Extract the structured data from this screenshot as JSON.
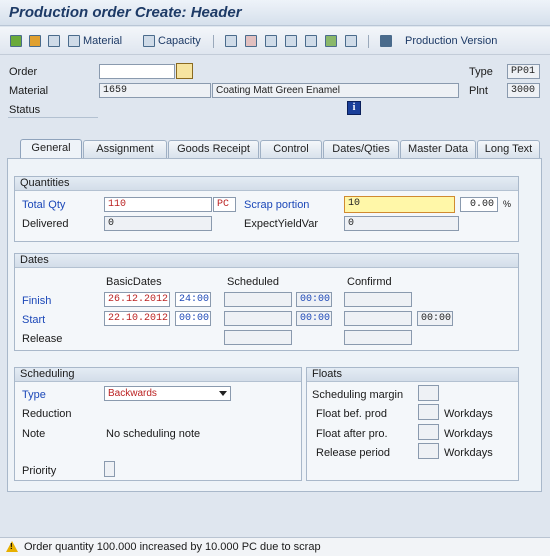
{
  "title": "Production order Create: Header",
  "toolbar": {
    "material_label": "Material",
    "capacity_label": "Capacity",
    "production_version_label": "Production Version"
  },
  "header": {
    "order_label": "Order",
    "order_value": "",
    "type_label": "Type",
    "type_value": "PP01",
    "material_label": "Material",
    "material_value": "1659",
    "material_desc": "Coating Matt Green Enamel",
    "plant_label": "Plnt",
    "plant_value": "3000",
    "status_label": "Status"
  },
  "tabs": [
    "General",
    "Assignment",
    "Goods Receipt",
    "Control",
    "Dates/Qties",
    "Master Data",
    "Long Text"
  ],
  "quantities": {
    "title": "Quantities",
    "total_qty_label": "Total Qty",
    "total_qty_value": "110",
    "unit": "PC",
    "scrap_portion_label": "Scrap portion",
    "scrap_portion_value": "10",
    "scrap_percent_value": "0.00",
    "percent_sign": "%",
    "delivered_label": "Delivered",
    "delivered_value": "0",
    "expect_yield_label": "ExpectYieldVar",
    "expect_yield_value": "0"
  },
  "dates": {
    "title": "Dates",
    "basic_dates_header": "BasicDates",
    "scheduled_header": "Scheduled",
    "confirmed_header": "Confirmd",
    "finish_label": "Finish",
    "finish_date": "26.12.2012",
    "finish_time": "24:00",
    "finish_sched_time": "00:00",
    "start_label": "Start",
    "start_date": "22.10.2012",
    "start_time": "00:00",
    "start_sched_time": "00:00",
    "start_conf_time": "00:00",
    "release_label": "Release"
  },
  "scheduling": {
    "title": "Scheduling",
    "type_label": "Type",
    "type_value": "Backwards",
    "reduction_label": "Reduction",
    "note_label": "Note",
    "note_value": "No scheduling note",
    "priority_label": "Priority"
  },
  "floats": {
    "title": "Floats",
    "scheduling_margin_label": "Scheduling margin",
    "float_bef_label": "Float bef. prod",
    "float_after_label": "Float after pro.",
    "release_period_label": "Release period",
    "unit": "Workdays"
  },
  "status_bar": {
    "message": "Order quantity 100.000 increased by 10.000 PC due to scrap"
  }
}
